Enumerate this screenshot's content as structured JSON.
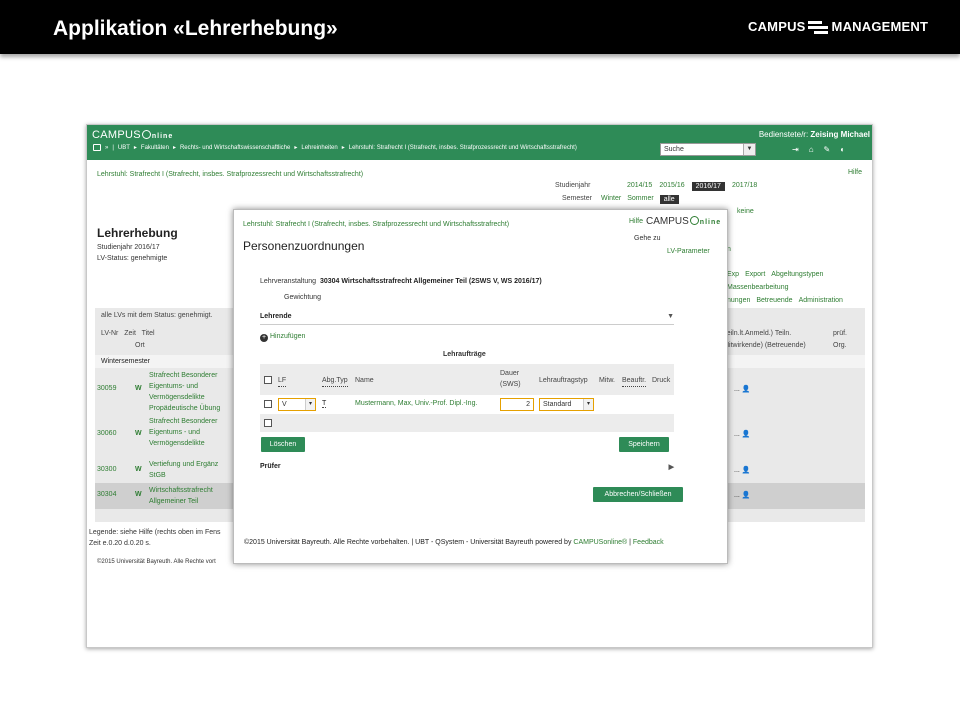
{
  "slide": {
    "title": "Applikation «Lehrerhebung»",
    "brand_left": "CAMPUS",
    "brand_right": "MANAGEMENT"
  },
  "topbar": {
    "logo_campus": "CAMPUS",
    "logo_online": "nline",
    "user_prefix": "Bedienstete/r: ",
    "user_name": "Zeising Michael",
    "breadcrumb": [
      "UBT",
      "Fakultäten",
      "Rechts- und Wirtschaftswissenschaftliche",
      "Lehreinheiten",
      "Lehrstuhl: Strafrecht I (Strafrecht, insbes. Strafprozessrecht und Wirtschaftsstrafrecht)"
    ],
    "search_value": "Suche",
    "icons": [
      "logout-icon",
      "home-icon",
      "edit-icon",
      "dashboard-icon"
    ]
  },
  "background": {
    "crumb": "Lehrstuhl: Strafrecht I (Strafrecht, insbes. Strafprozessrecht und Wirtschaftsstrafrecht)",
    "hilfe": "Hilfe",
    "studienjahr_label": "Studienjahr",
    "years": [
      "2014/15",
      "2015/16",
      "2016/17",
      "2017/18"
    ],
    "active_year": "2016/17",
    "semester_label": "Semester",
    "semesters": [
      "Winter",
      "Sommer",
      "alle"
    ],
    "keine": "keine",
    "page_title": "Lehrerhebung",
    "studienjahr_line": "Studienjahr 2016/17",
    "status_line": "LV-Status: genehmigte",
    "partial_n": "n",
    "links_row1": [
      "Export",
      "Abgeltungstypen"
    ],
    "links_row1_prefix": "Exp",
    "links_row2": "Massenbearbeitung",
    "links_row3": [
      "nungen",
      "Betreuende",
      "Administration"
    ],
    "list_status": "alle LVs mit dem Status: genehmigt.",
    "col_nr": "LV-Nr",
    "col_zeit": "Zeit",
    "col_ort": "Ort",
    "col_titel": "Titel",
    "col_right1": "/ (Teiln.lt.Anmeld.) Teiln.",
    "col_right2": "] (Mitwirkende) (Betreuende)",
    "col_pruef": "prüf.",
    "col_org": "Org.",
    "wintersemester": "Wintersemester",
    "rows": [
      {
        "nr": "30059",
        "zeit": "W",
        "titel": "Strafrecht Besonderer Teil Eigentums- und Vermögensdelikte Propädeutische Übung",
        "act": "...",
        "lines": [
          "Strafrecht Besonderer",
          "Eigentums- und",
          "Vermögensdelikte",
          "Propädeutische Übung"
        ]
      },
      {
        "nr": "30060",
        "zeit": "W",
        "titel": "Strafrecht Besonderer Teil Eigentums - und Vermögensdelikte",
        "act": "...",
        "lines": [
          "Strafrecht Besonderer",
          "Eigentums - und",
          "Vermögensdelikte"
        ]
      },
      {
        "nr": "30300",
        "zeit": "W",
        "titel": "Vertiefung und Ergänzung StGB",
        "act": "...",
        "lines": [
          "Vertiefung und Ergänz",
          "StGB"
        ]
      },
      {
        "nr": "30304",
        "zeit": "W",
        "titel": "Wirtschaftsstrafrecht Allgemeiner Teil",
        "act": "...",
        "lines": [
          "Wirtschaftsstrafrecht",
          "Allgemeiner Teil"
        ]
      }
    ],
    "legend": "Legende: siehe Hilfe (rechts oben im Fens",
    "zeit_line": "Zeit e.0.20 d.0.20 s.",
    "copyright": "©2015 Universität Bayreuth. Alle Rechte vort"
  },
  "modal": {
    "crumb": "Lehrstuhl: Strafrecht I (Strafrecht, insbes. Strafprozessrecht und Wirtschaftsstrafrecht)",
    "hilfe": "Hilfe",
    "logo_campus": "CAMPUS",
    "logo_online": "nline",
    "title": "Personenzuordnungen",
    "gehe_zu": "Gehe zu",
    "lv_parameter": "LV-Parameter",
    "lv_label": "Lehrveranstaltung",
    "lv_value": "30304 Wirtschaftsstrafrecht Allgemeiner Teil (2SWS V, WS 2016/17)",
    "gewichtung": "Gewichtung",
    "lehrende": "Lehrende",
    "hinzufuegen": "Hinzufügen",
    "lehrauftraege": "Lehraufträge",
    "cols": {
      "lf": "LF",
      "abg_typ": "Abg.Typ",
      "name": "Name",
      "dauer1": "Dauer",
      "dauer2": "(SWS)",
      "lehrauftragstyp": "Lehrauftragstyp",
      "mitw": "Mitw.",
      "beauftr": "Beauftr.",
      "druck": "Druck"
    },
    "row": {
      "lf": "V",
      "typ": "T",
      "name": "Mustermann, Max, Univ.-Prof. Dipl.-Ing.",
      "dauer": "2",
      "lehrauftragstyp": "Standard"
    },
    "btn_loeschen": "Löschen",
    "btn_speichern": "Speichern",
    "pruefer": "Prüfer",
    "btn_close": "Abbrechen/Schließen",
    "footer_text": "©2015 Universität Bayreuth. Alle Rechte vorbehalten. | UBT - QSystem - Universität Bayreuth powered by ",
    "footer_link": "CAMPUSonline®",
    "footer_sep": " | ",
    "footer_feedback": "Feedback"
  },
  "colors": {
    "brand_green": "#2e8b57",
    "link_green": "#2e7d32",
    "field_highlight": "#e5a000"
  }
}
